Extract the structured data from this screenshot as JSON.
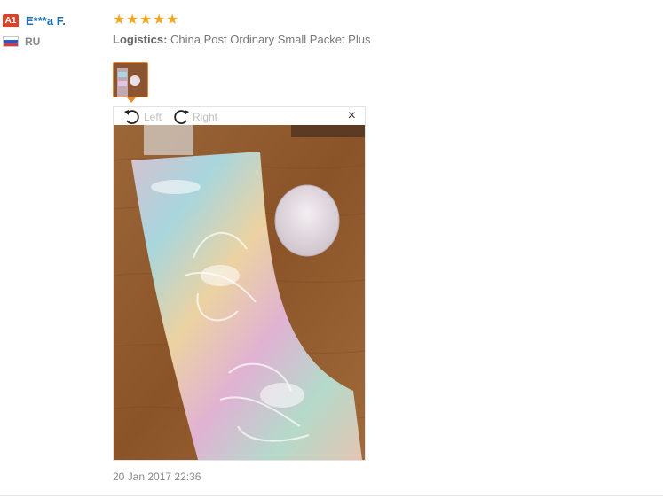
{
  "buyer": {
    "level_badge": "A1",
    "name": "E***a F.",
    "country": "RU",
    "flag_colors": [
      "#ffffff",
      "#1f4fb5",
      "#d22a2a"
    ]
  },
  "review": {
    "rating": 5,
    "stars": [
      "★",
      "★",
      "★",
      "★",
      "★"
    ],
    "star_color": "#f5a623",
    "logistics_label": "Logistics:",
    "logistics_value": "China Post Ordinary Small Packet Plus",
    "date": "20 Jan 2017 22:36"
  },
  "image_viewer": {
    "rotate_left_label": "Left",
    "rotate_right_label": "Right",
    "close_glyph": "×",
    "accent_color": "#e8882c"
  }
}
